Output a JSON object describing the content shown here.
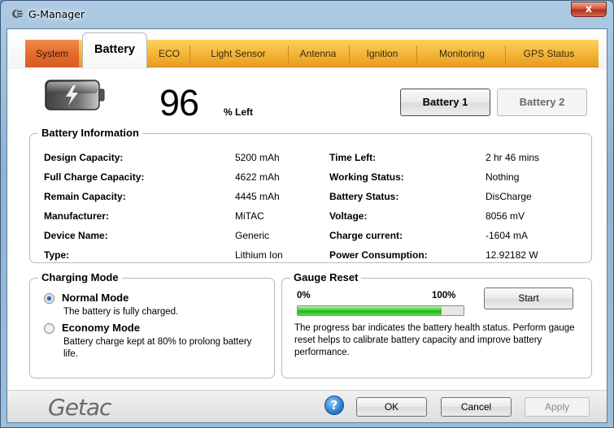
{
  "window": {
    "title": "G-Manager",
    "close_label": "x"
  },
  "tabs": [
    {
      "label": "System"
    },
    {
      "label": "Battery"
    },
    {
      "label": "ECO"
    },
    {
      "label": "Light Sensor"
    },
    {
      "label": "Antenna"
    },
    {
      "label": "Ignition"
    },
    {
      "label": "Monitoring"
    },
    {
      "label": "GPS Status"
    }
  ],
  "active_tab": "Battery",
  "battery": {
    "percent": "96",
    "percent_suffix": "% Left",
    "selector": {
      "battery1_label": "Battery 1",
      "battery2_label": "Battery 2"
    }
  },
  "info": {
    "title": "Battery Information",
    "left": [
      {
        "label": "Design Capacity:",
        "value": "5200 mAh"
      },
      {
        "label": "Full Charge Capacity:",
        "value": "4622 mAh"
      },
      {
        "label": "Remain Capacity:",
        "value": "4445 mAh"
      },
      {
        "label": "Manufacturer:",
        "value": "MiTAC"
      },
      {
        "label": "Device Name:",
        "value": "Generic"
      },
      {
        "label": "Type:",
        "value": "Lithium Ion"
      }
    ],
    "right": [
      {
        "label": "Time Left:",
        "value": "2 hr 46 mins"
      },
      {
        "label": "Working Status:",
        "value": "Nothing"
      },
      {
        "label": "Battery Status:",
        "value": "DisCharge"
      },
      {
        "label": "Voltage:",
        "value": "8056 mV"
      },
      {
        "label": "Charge current:",
        "value": "-1604 mA"
      },
      {
        "label": "Power Consumption:",
        "value": "12.92182 W"
      }
    ]
  },
  "charging": {
    "title": "Charging Mode",
    "normal": {
      "label": "Normal Mode",
      "desc": "The battery is fully charged.",
      "selected": true
    },
    "economy": {
      "label": "Economy Mode",
      "desc": "Battery charge kept at 80% to prolong battery life.",
      "selected": false
    }
  },
  "gauge": {
    "title": "Gauge Reset",
    "min_label": "0%",
    "max_label": "100%",
    "progress_fraction": 0.87,
    "start_label": "Start",
    "desc": "The progress bar indicates the battery health status. Perform gauge reset helps to calibrate battery capacity and improve battery performance."
  },
  "footer": {
    "logo": "Getac",
    "help_icon": "question-icon",
    "help_glyph": "?",
    "ok_label": "OK",
    "cancel_label": "Cancel",
    "apply_label": "Apply"
  }
}
